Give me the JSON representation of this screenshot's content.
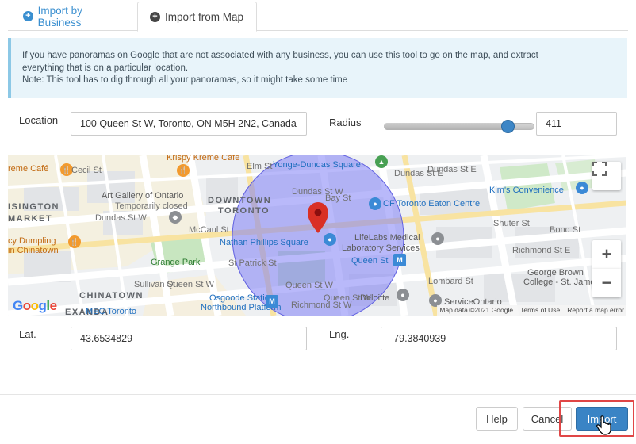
{
  "tabs": [
    {
      "label": "Import by Business",
      "icon": "plus-circle-icon",
      "active": false
    },
    {
      "label": "Import from Map",
      "icon": "plus-circle-icon",
      "active": true
    }
  ],
  "alert": {
    "line1": "If you have panoramas on Google that are not associated with any business, you can use this tool to go on the map, and extract",
    "line2": "everything that is on a particular location.",
    "line3": "Note: This tool has to dig through all your panoramas, so it might take some time"
  },
  "form": {
    "location_label": "Location",
    "location_value": "100 Queen St W, Toronto, ON M5H 2N2, Canada",
    "radius_label": "Radius",
    "radius_value": "411",
    "radius_fraction": 0.82,
    "lat_label": "Lat.",
    "lat_value": "43.6534829",
    "lng_label": "Lng.",
    "lng_value": "-79.3840939"
  },
  "map": {
    "labels": {
      "downtown": "DOWNTOWN",
      "toronto": "TORONTO",
      "chinatown": "CHINATOWN",
      "kensington": "ISINGTON",
      "market": "MARKET",
      "krispy": "Krispy Kreme Cafe",
      "reme": "reme Café",
      "yonge_dundas": "Yonge-Dundas Square",
      "art_gallery": "Art Gallery of Ontario",
      "temp_closed": "Temporarily closed",
      "kims": "Kim's Convenience",
      "cf_eaton": "CF Toronto Eaton Centre",
      "dumpling": "cy Dumpling",
      "in_chinatown": "in Chinatown",
      "nathan": "Nathan Phillips Square",
      "lifelabs1": "LifeLabs Medical",
      "lifelabs2": "Laboratory Services",
      "grange": "Grange Park",
      "queen_st": "Queen St",
      "george_brown1": "George Brown",
      "george_brown2": "College - St. James...",
      "osgoode1": "Osgoode Station",
      "osgoode2": "Northbound Platform",
      "deloitte": "Deloitte",
      "serviceontario": "ServiceOntario",
      "mec": "MEC Toronto",
      "exanda": "EXANDA"
    },
    "streets": {
      "elm": "Elm St",
      "cecil": "Cecil St",
      "dundas_w1": "Dundas St W",
      "dundas_w2": "Dundas St W",
      "dundas_e1": "Dundas St E",
      "dundas_e2": "Dundas St E",
      "bay": "Bay St",
      "mccaul": "McCaul St",
      "stpatrick": "St Patrick St",
      "queen_w1": "Queen St W",
      "queen_w2": "Queen St W",
      "queen_w3": "Queen St W",
      "richmond_w": "Richmond St W",
      "richmond_e": "Richmond St E",
      "lombard": "Lombard St",
      "sullivan": "Sullivan St",
      "shuter": "Shuter St",
      "bond": "Bond St"
    },
    "google_logo": [
      "G",
      "o",
      "o",
      "g",
      "l",
      "e"
    ],
    "attribution": {
      "data": "Map data ©2021 Google",
      "terms": "Terms of Use",
      "report": "Report a map error"
    },
    "zoom_in": "+",
    "zoom_out": "−"
  },
  "footer": {
    "help_label": "Help",
    "cancel_label": "Cancel",
    "import_label": "Import"
  },
  "colors": {
    "primary": "#3a84c5",
    "tab_link": "#3a8fd0",
    "alert_bg": "#e8f4fa",
    "radius_circle": "#7f7ff5",
    "marker": "#d93025",
    "highlight": "#e04646"
  }
}
